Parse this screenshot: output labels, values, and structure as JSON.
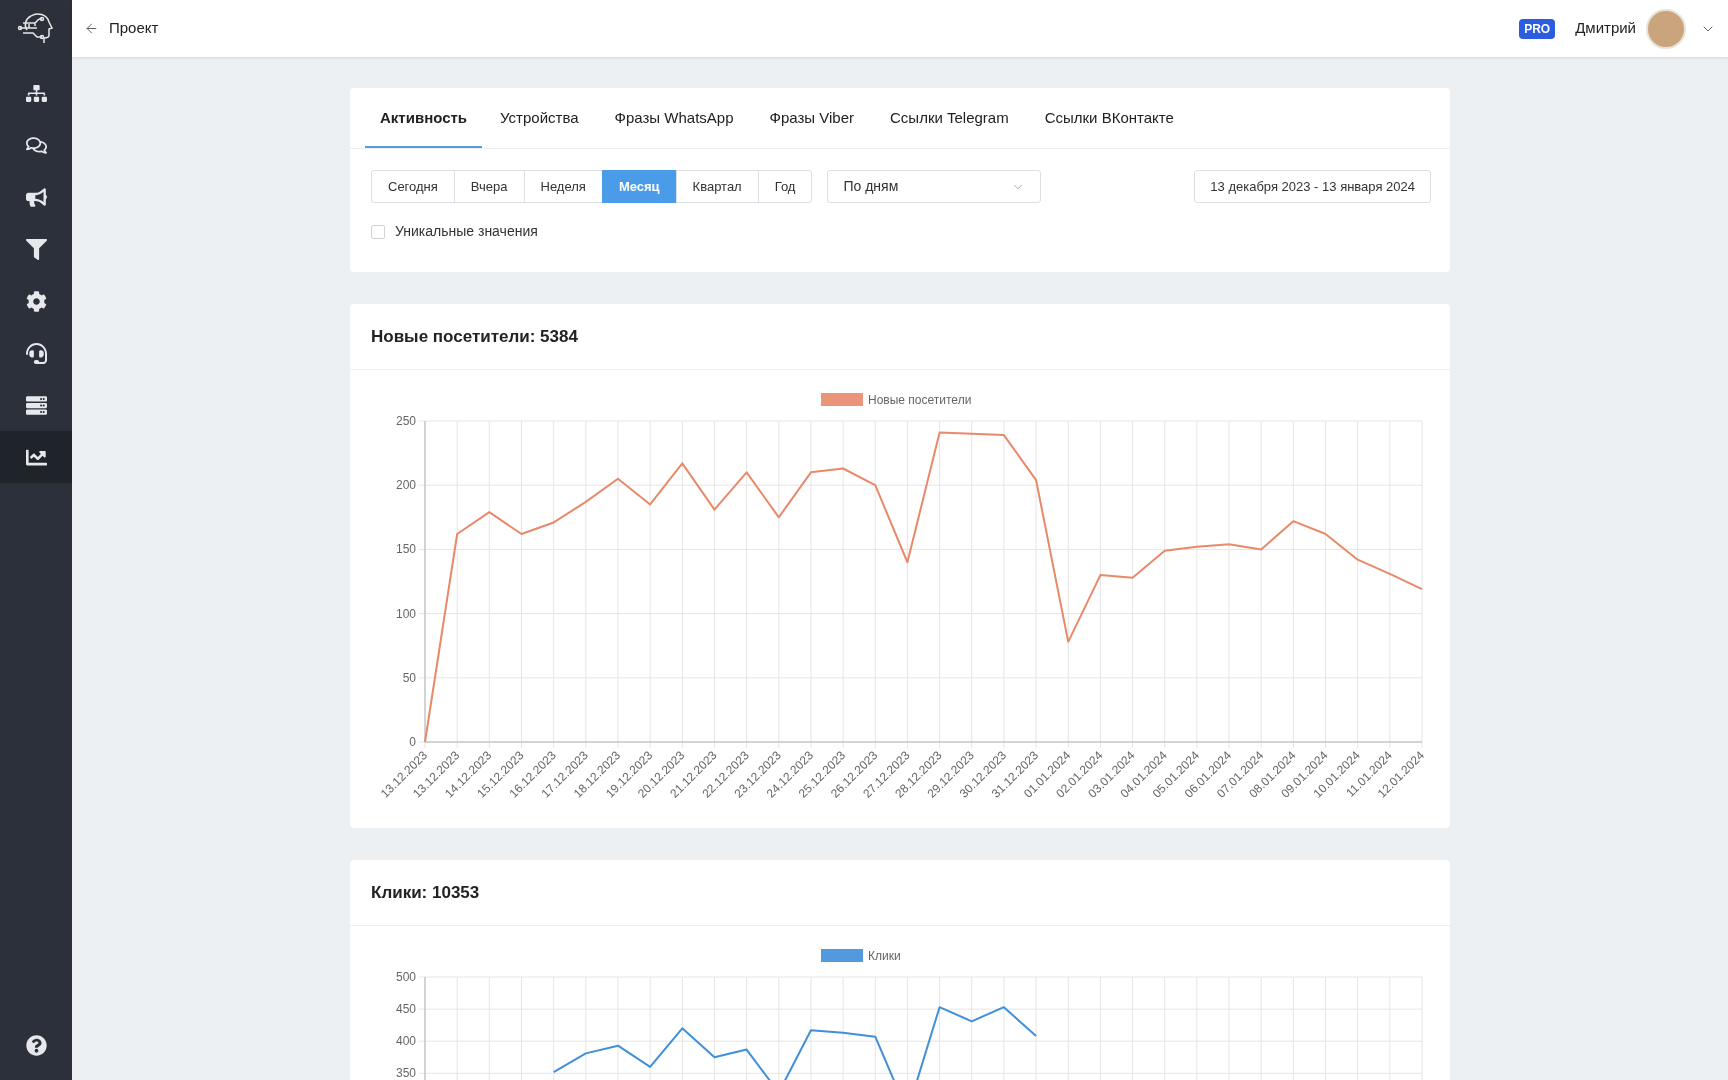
{
  "header": {
    "back_label": "Проект",
    "badge": "PRO",
    "user_name": "Дмитрий"
  },
  "sidebar": {
    "items": [
      {
        "selected": false
      },
      {
        "selected": false
      },
      {
        "selected": false
      },
      {
        "selected": false
      },
      {
        "selected": false
      },
      {
        "selected": false
      },
      {
        "selected": false
      },
      {
        "selected": true
      }
    ]
  },
  "tabs": [
    {
      "label": "Активность",
      "selected": true
    },
    {
      "label": "Устройства",
      "selected": false
    },
    {
      "label": "Фразы WhatsApp",
      "selected": false
    },
    {
      "label": "Фразы Viber",
      "selected": false
    },
    {
      "label": "Ссылки Telegram",
      "selected": false
    },
    {
      "label": "Ссылки ВКонтакте",
      "selected": false
    }
  ],
  "periods": [
    {
      "label": "Сегодня",
      "selected": false
    },
    {
      "label": "Вчера",
      "selected": false
    },
    {
      "label": "Неделя",
      "selected": false
    },
    {
      "label": "Месяц",
      "selected": true
    },
    {
      "label": "Квартал",
      "selected": false
    },
    {
      "label": "Год",
      "selected": false
    }
  ],
  "grouping": {
    "value": "По дням"
  },
  "date_range": "13 декабря 2023 - 13 января 2024",
  "unique_values": {
    "label": "Уникальные значения",
    "checked": false
  },
  "charts": [
    {
      "title": "Новые посетители: 5384",
      "chart_data": {
        "type": "line",
        "categories": [
          "13.12.2023",
          "13.12.2023",
          "14.12.2023",
          "15.12.2023",
          "16.12.2023",
          "17.12.2023",
          "18.12.2023",
          "19.12.2023",
          "20.12.2023",
          "21.12.2023",
          "22.12.2023",
          "23.12.2023",
          "24.12.2023",
          "25.12.2023",
          "26.12.2023",
          "27.12.2023",
          "28.12.2023",
          "29.12.2023",
          "30.12.2023",
          "31.12.2023",
          "01.01.2024",
          "02.01.2024",
          "03.01.2024",
          "04.01.2024",
          "05.01.2024",
          "06.01.2024",
          "07.01.2024",
          "08.01.2024",
          "09.01.2024",
          "10.01.2024",
          "11.01.2024",
          "12.01.2024"
        ],
        "series": [
          {
            "name": "Новые посетители",
            "color": "#e8896a",
            "values": [
              0,
              162,
              179,
              162,
              171,
              187,
              205,
              185,
              217,
              181,
              210,
              175,
              210,
              213,
              200,
              140,
              241,
              240,
              239,
              204,
              78,
              130,
              128,
              149,
              152,
              154,
              150,
              172,
              162,
              142,
              131,
              119
            ]
          }
        ],
        "ylim": [
          0,
          250
        ],
        "yticks": [
          0,
          50,
          100,
          150,
          200,
          250
        ],
        "grid": true
      }
    },
    {
      "title": "Клики: 10353",
      "chart_data": {
        "type": "line",
        "series": [
          {
            "name": "Клики",
            "color": "#3f8fd9",
            "values": [
              null,
              null,
              null,
              null,
              352,
              381,
              393,
              360,
              420,
              375,
              387,
              320,
              417,
              413,
              407,
              290,
              453,
              431,
              453,
              408,
              null,
              null,
              null,
              null,
              null,
              null,
              null,
              null,
              null,
              null,
              null,
              null
            ]
          }
        ],
        "ylim": [
          0,
          500
        ],
        "yticks": [
          350,
          400,
          450,
          500
        ],
        "grid": true
      }
    }
  ]
}
